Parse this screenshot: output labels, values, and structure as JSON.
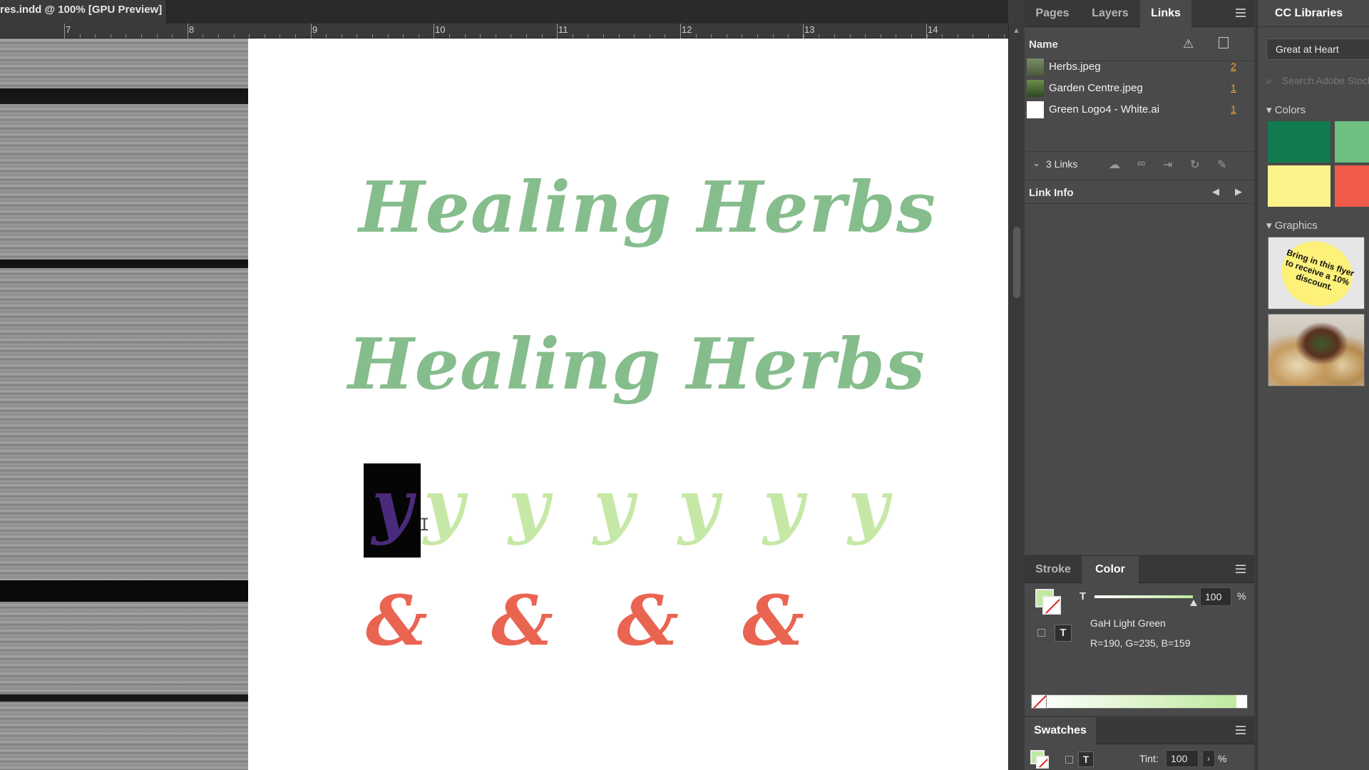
{
  "document": {
    "tab_title": "res.indd @ 100% [GPU Preview]"
  },
  "ruler": {
    "numbers": [
      "7",
      "8",
      "9",
      "10",
      "11",
      "12",
      "13",
      "14"
    ]
  },
  "canvas": {
    "title_line1": "Healing Herbs",
    "title_line2": "Healing Herbs",
    "glyph_selected": "y",
    "glyph_alternates": "y y y y y y",
    "ampersands": "& & & &"
  },
  "links_panel": {
    "tabs": [
      "Pages",
      "Layers",
      "Links"
    ],
    "active_tab": "Links",
    "column_name": "Name",
    "links": [
      {
        "name": "Herbs.jpeg",
        "page": "2"
      },
      {
        "name": "Garden Centre.jpeg",
        "page": "1"
      },
      {
        "name": "Green Logo4 - White.ai",
        "page": "1"
      }
    ],
    "count_label": "3 Links",
    "link_info_label": "Link Info"
  },
  "color_panel": {
    "tabs": [
      "Stroke",
      "Color"
    ],
    "active_tab": "Color",
    "channel_label": "T",
    "value": "100",
    "percent": "%",
    "swatch_name": "GaH Light Green",
    "rgb": "R=190, G=235, B=159",
    "fill_color": "#bfe9a0"
  },
  "swatches_panel": {
    "title": "Swatches",
    "tint_label": "Tint:",
    "tint_value": "100",
    "percent": "%"
  },
  "cc_libraries": {
    "title": "CC Libraries",
    "library_name": "Great at Heart",
    "search_placeholder": "Search Adobe Stock",
    "sections": {
      "colors": "Colors",
      "graphics": "Graphics"
    },
    "colors": [
      "#117a4e",
      "#6dc07f",
      "#fdf38b",
      "#f15b4b"
    ],
    "badge_text": "Bring in this flyer to receive a 10% discount."
  }
}
